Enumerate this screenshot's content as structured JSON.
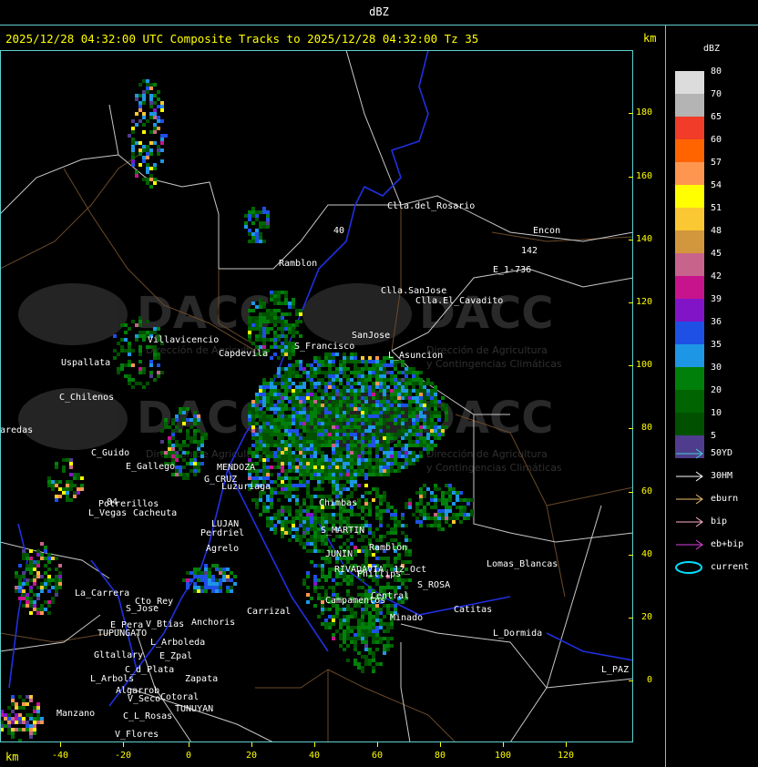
{
  "header": {
    "title": "dBZ"
  },
  "subtitle": "2025/12/28 04:32:00 UTC Composite Tracks to 2025/12/28 04:32:00 Tz 35",
  "axis": {
    "unit_top": "km",
    "unit_bottom": "km",
    "y_ticks": [
      "180",
      "160",
      "140",
      "120",
      "100",
      "80",
      "60",
      "40",
      "20",
      "0"
    ],
    "x_ticks": [
      "-40",
      "-20",
      "0",
      "20",
      "40",
      "60",
      "80",
      "100",
      "120"
    ]
  },
  "legend": {
    "title": "dBZ",
    "items": [
      {
        "value": "80",
        "color": "#dcdcdc"
      },
      {
        "value": "70",
        "color": "#b4b4b4"
      },
      {
        "value": "65",
        "color": "#f03c28"
      },
      {
        "value": "60",
        "color": "#ff6400"
      },
      {
        "value": "57",
        "color": "#ff9650"
      },
      {
        "value": "54",
        "color": "#ffff00"
      },
      {
        "value": "51",
        "color": "#fac832"
      },
      {
        "value": "48",
        "color": "#d2963c"
      },
      {
        "value": "45",
        "color": "#c8648c"
      },
      {
        "value": "42",
        "color": "#c8148c"
      },
      {
        "value": "39",
        "color": "#8214c8"
      },
      {
        "value": "36",
        "color": "#1e50e6"
      },
      {
        "value": "35",
        "color": "#1e96e6"
      },
      {
        "value": "30",
        "color": "#00800a"
      },
      {
        "value": "20",
        "color": "#006400"
      },
      {
        "value": "10",
        "color": "#005000"
      },
      {
        "value": "5",
        "color": "#503c8c"
      }
    ]
  },
  "tracks": [
    {
      "label": "50YD",
      "color": "#40d0d0",
      "icon": "arrow-icon"
    },
    {
      "label": "30HM",
      "color": "#ffffff",
      "icon": "arrow-icon"
    },
    {
      "label": "eburn",
      "color": "#f0c070",
      "icon": "arrow-icon"
    },
    {
      "label": "bip",
      "color": "#ffb0d0",
      "icon": "arrow-icon"
    },
    {
      "label": "eb+bip",
      "color": "#e040e0",
      "icon": "arrow-icon"
    },
    {
      "label": "current",
      "color": "#00e0ff",
      "icon": "ellipse-icon"
    }
  ],
  "watermark": {
    "brand": "DACC",
    "line1": "Dirección de Agricultura",
    "line2": "y Contingencias Climáticas"
  },
  "places": [
    {
      "name": "Clla.del_Rosario"
    },
    {
      "name": "Encon"
    },
    {
      "name": "Ramblon"
    },
    {
      "name": "E_1-736"
    },
    {
      "name": "Clla.SanJose"
    },
    {
      "name": "Clla.El_Cavadito"
    },
    {
      "name": "Villavicencio"
    },
    {
      "name": "S_Francisco"
    },
    {
      "name": "SanJose"
    },
    {
      "name": "L_Asuncion"
    },
    {
      "name": "Capdevila"
    },
    {
      "name": "Uspallata"
    },
    {
      "name": "C_Chilenos"
    },
    {
      "name": "C_Guido"
    },
    {
      "name": "E_Gallego"
    },
    {
      "name": "MENDOZA"
    },
    {
      "name": "G_CRUZ"
    },
    {
      "name": "Luzuriaga"
    },
    {
      "name": "Potrerillos"
    },
    {
      "name": "L_Vegas"
    },
    {
      "name": "Cacheuta"
    },
    {
      "name": "LUJAN"
    },
    {
      "name": "Perdriel"
    },
    {
      "name": "Agrelo"
    },
    {
      "name": "Chimbas"
    },
    {
      "name": "S_MARTIN"
    },
    {
      "name": "Ramblon"
    },
    {
      "name": "JUNIN"
    },
    {
      "name": "RIVADAVIA"
    },
    {
      "name": "Phillips"
    },
    {
      "name": "12_Oct"
    },
    {
      "name": "Lomas_Blancas"
    },
    {
      "name": "S_ROSA"
    },
    {
      "name": "La_Carrera"
    },
    {
      "name": "Cto_Rey"
    },
    {
      "name": "S_Jose"
    },
    {
      "name": "E_Pera"
    },
    {
      "name": "V_Btias"
    },
    {
      "name": "Anchoris"
    },
    {
      "name": "Carrizal"
    },
    {
      "name": "Campamentos"
    },
    {
      "name": "Central"
    },
    {
      "name": "Catitas"
    },
    {
      "name": "TUPUNGATO"
    },
    {
      "name": "L_Arboleda"
    },
    {
      "name": "Minado"
    },
    {
      "name": "L_Dormida"
    },
    {
      "name": "Gltallary"
    },
    {
      "name": "E_Zpal"
    },
    {
      "name": "L_Arbols"
    },
    {
      "name": "C_d_Plata"
    },
    {
      "name": "Zapata"
    },
    {
      "name": "V_Seco"
    },
    {
      "name": "Cotoral"
    },
    {
      "name": "Algarrob"
    },
    {
      "name": "TUNUYAN"
    },
    {
      "name": "Manzano"
    },
    {
      "name": "C_L_Rosas"
    },
    {
      "name": "V_Flores"
    },
    {
      "name": "L_PAZ"
    },
    {
      "name": "aredas"
    },
    {
      "name": "142"
    },
    {
      "name": "40"
    },
    {
      "name": "84"
    }
  ]
}
